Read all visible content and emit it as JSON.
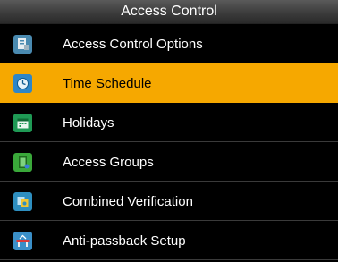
{
  "header": {
    "title": "Access Control"
  },
  "menu": {
    "selected_index": 1,
    "items": [
      {
        "label": "Access Control Options",
        "icon": "access-control-options-icon",
        "color": "#4a8ab0"
      },
      {
        "label": "Time Schedule",
        "icon": "time-schedule-icon",
        "color": "#2f86c7"
      },
      {
        "label": "Holidays",
        "icon": "holidays-icon",
        "color": "#1f9a55"
      },
      {
        "label": "Access Groups",
        "icon": "access-groups-icon",
        "color": "#3aa83a"
      },
      {
        "label": "Combined Verification",
        "icon": "combined-verification-icon",
        "color": "#2e8fc0"
      },
      {
        "label": "Anti-passback Setup",
        "icon": "anti-passback-icon",
        "color": "#3a8fc8"
      }
    ]
  },
  "colors": {
    "highlight": "#f6a800",
    "background": "#000000",
    "title_bar": "#3c3c3c"
  }
}
